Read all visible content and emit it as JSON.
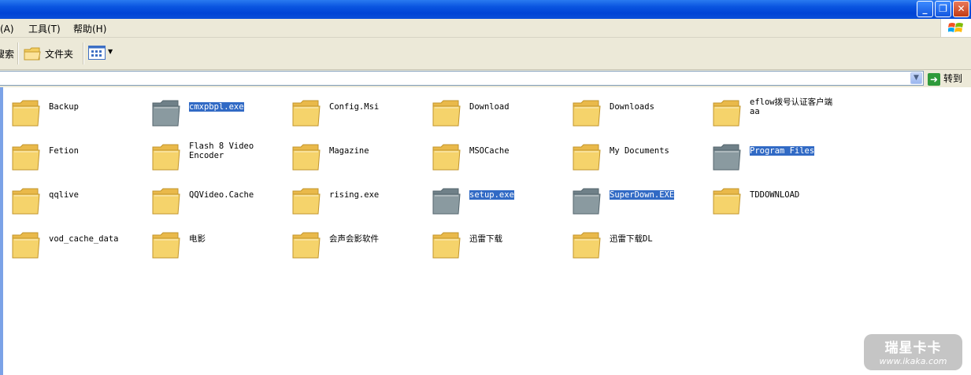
{
  "colors": {
    "titlebar": "#0044d6",
    "selection": "#316ac5",
    "folder_normal": "#f5d36b",
    "folder_hidden": "#8a9aa0"
  },
  "menu": {
    "view_suffix": "看(A)",
    "tools": "工具(T)",
    "help": "帮助(H)"
  },
  "toolbar": {
    "search_label": "搜索",
    "folders_label": "文件夹",
    "views_icon": "views-icon"
  },
  "address": {
    "go_label": "转到",
    "dropdown_icon": "chevron-down-icon"
  },
  "items": [
    {
      "name": "Backup",
      "style": "normal"
    },
    {
      "name": "cmxpbpl.exe",
      "style": "hidden"
    },
    {
      "name": "Config.Msi",
      "style": "normal"
    },
    {
      "name": "Download",
      "style": "normal"
    },
    {
      "name": "Downloads",
      "style": "normal"
    },
    {
      "name": "eflow拨号认证客户端\naa",
      "style": "normal"
    },
    {
      "name": "Fetion",
      "style": "normal"
    },
    {
      "name": "Flash 8 Video\nEncoder",
      "style": "normal"
    },
    {
      "name": "Magazine",
      "style": "normal"
    },
    {
      "name": "MSOCache",
      "style": "normal"
    },
    {
      "name": "My Documents",
      "style": "normal"
    },
    {
      "name": "Program Files",
      "style": "hidden"
    },
    {
      "name": "qqlive",
      "style": "normal"
    },
    {
      "name": "QQVideo.Cache",
      "style": "normal"
    },
    {
      "name": "rising.exe",
      "style": "normal"
    },
    {
      "name": "setup.exe",
      "style": "hidden"
    },
    {
      "name": "SuperDown.EXE",
      "style": "hidden"
    },
    {
      "name": "TDDOWNLOAD",
      "style": "normal"
    },
    {
      "name": "vod_cache_data",
      "style": "normal"
    },
    {
      "name": "电影",
      "style": "normal"
    },
    {
      "name": "会声会影软件",
      "style": "normal"
    },
    {
      "name": "迅雷下载",
      "style": "normal"
    },
    {
      "name": "迅雷下载DL",
      "style": "normal"
    }
  ],
  "watermark": {
    "line1": "瑞星卡卡",
    "line2": "www.ikaka.com"
  }
}
